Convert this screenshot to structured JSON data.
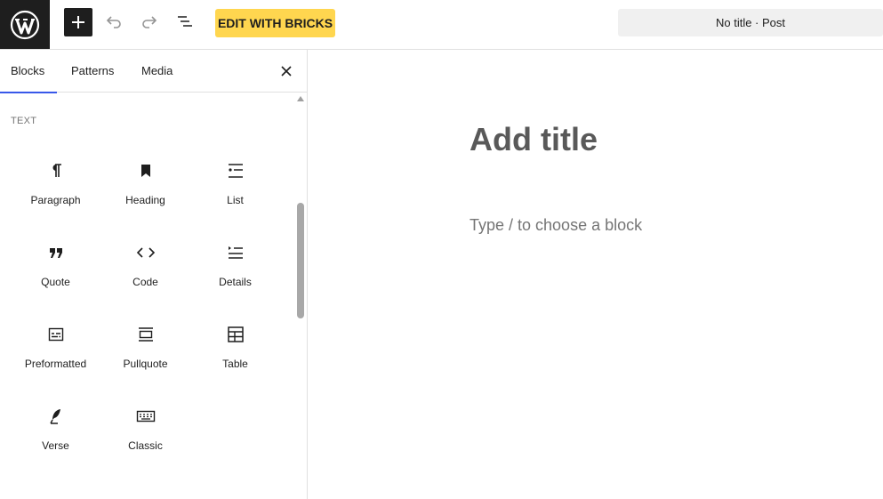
{
  "topbar": {
    "logo_icon": "wordpress-logo-icon",
    "add_icon": "plus-icon",
    "undo_icon": "undo-icon",
    "redo_icon": "redo-icon",
    "outline_icon": "document-overview-icon",
    "bricks_label": "EDIT WITH BRICKS",
    "document_label": "No title · Post"
  },
  "sidebar": {
    "tabs": [
      {
        "label": "Blocks",
        "active": true
      },
      {
        "label": "Patterns",
        "active": false
      },
      {
        "label": "Media",
        "active": false
      }
    ],
    "close_icon": "close-icon",
    "section_label": "TEXT",
    "blocks": [
      {
        "label": "Paragraph",
        "icon": "paragraph-icon"
      },
      {
        "label": "Heading",
        "icon": "heading-bookmark-icon"
      },
      {
        "label": "List",
        "icon": "list-icon"
      },
      {
        "label": "Quote",
        "icon": "quote-icon"
      },
      {
        "label": "Code",
        "icon": "code-icon"
      },
      {
        "label": "Details",
        "icon": "details-icon"
      },
      {
        "label": "Preformatted",
        "icon": "preformatted-icon"
      },
      {
        "label": "Pullquote",
        "icon": "pullquote-icon"
      },
      {
        "label": "Table",
        "icon": "table-icon"
      },
      {
        "label": "Verse",
        "icon": "verse-feather-icon"
      },
      {
        "label": "Classic",
        "icon": "keyboard-icon"
      }
    ]
  },
  "editor": {
    "title_placeholder": "Add title",
    "block_placeholder": "Type / to choose a block"
  },
  "colors": {
    "accent": "#3858e9",
    "bricks_yellow": "#ffd64f",
    "dark": "#1e1e1e"
  }
}
